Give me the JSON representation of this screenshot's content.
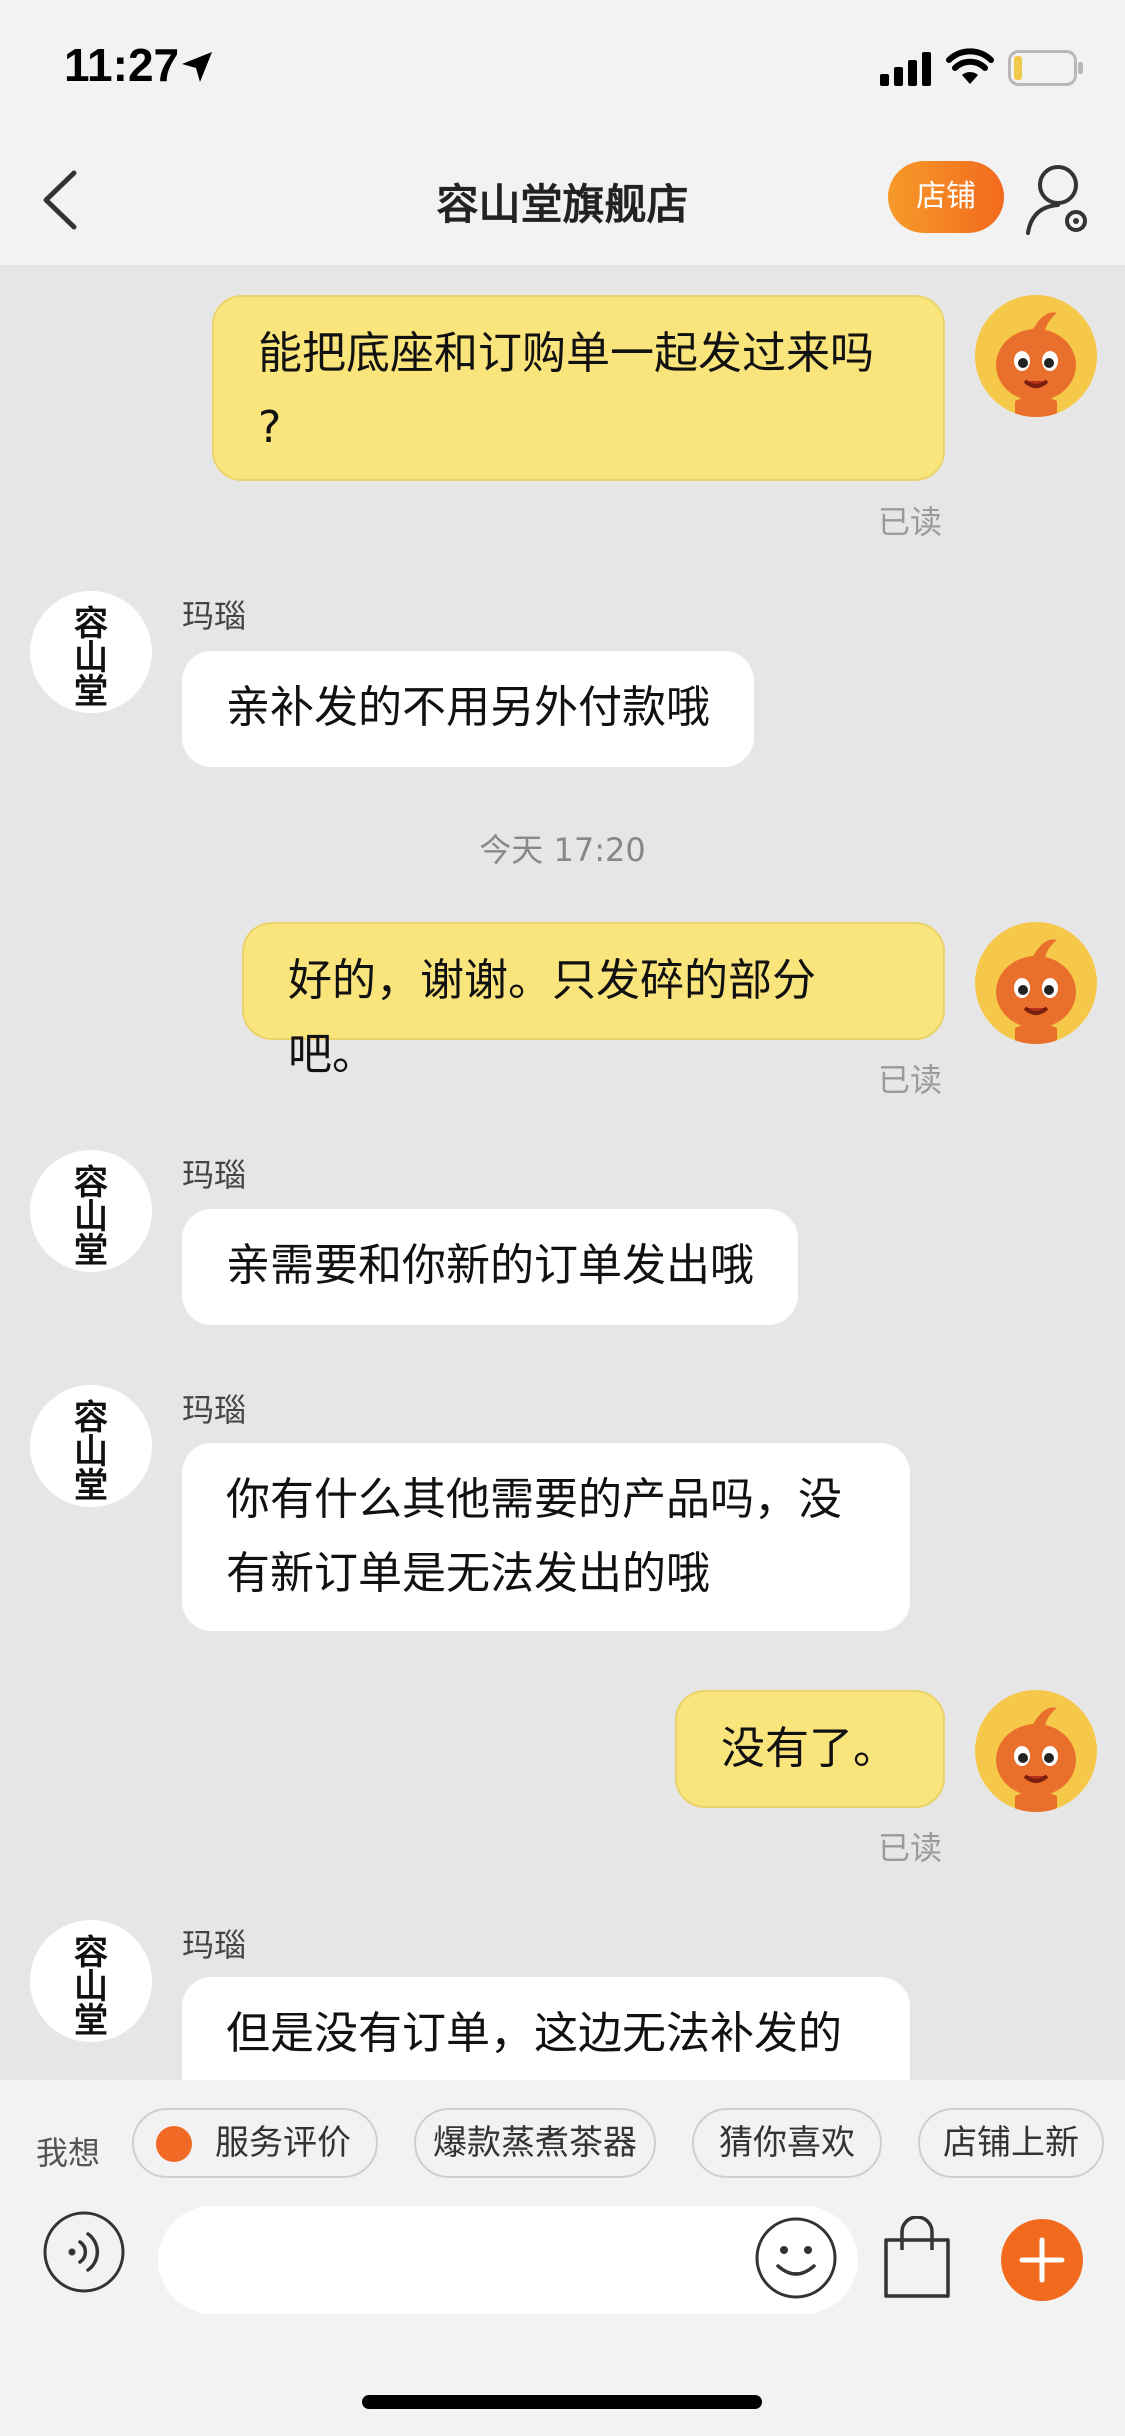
{
  "status_bar": {
    "time": "11:27"
  },
  "header": {
    "title": "容山堂旗舰店",
    "store_label": "店铺"
  },
  "chat": {
    "messages": [
      {
        "side": "me",
        "text_lines": [
          "能把底座和订购单一起发过来吗",
          "?"
        ],
        "read": "已读"
      },
      {
        "side": "them",
        "sender": "玛瑙",
        "text": "亲补发的不用另外付款哦"
      },
      {
        "side": "me",
        "text": "好的，谢谢。只发碎的部分吧。",
        "read": "已读"
      },
      {
        "side": "them",
        "sender": "玛瑙",
        "text": "亲需要和你新的订单发出哦"
      },
      {
        "side": "them",
        "sender": "玛瑙",
        "text_lines": [
          "你有什么其他需要的产品吗，没",
          "有新订单是无法发出的哦"
        ]
      },
      {
        "side": "me",
        "text": "没有了。",
        "read": "已读"
      },
      {
        "side": "them",
        "sender": "玛瑙",
        "text": "但是没有订单，这边无法补发的"
      }
    ],
    "timestamp": "今天 17:20",
    "shop_avatar_text": [
      "容",
      "山",
      "堂"
    ]
  },
  "quick_replies": {
    "label": "我想",
    "chips": [
      "服务评价",
      "爆款蒸煮茶器",
      "猜你喜欢",
      "店铺上新"
    ]
  },
  "input": {
    "placeholder": ""
  },
  "colors": {
    "accent": "#f16a1d",
    "my_bubble": "#fae57d",
    "background": "#e6e6e6"
  }
}
